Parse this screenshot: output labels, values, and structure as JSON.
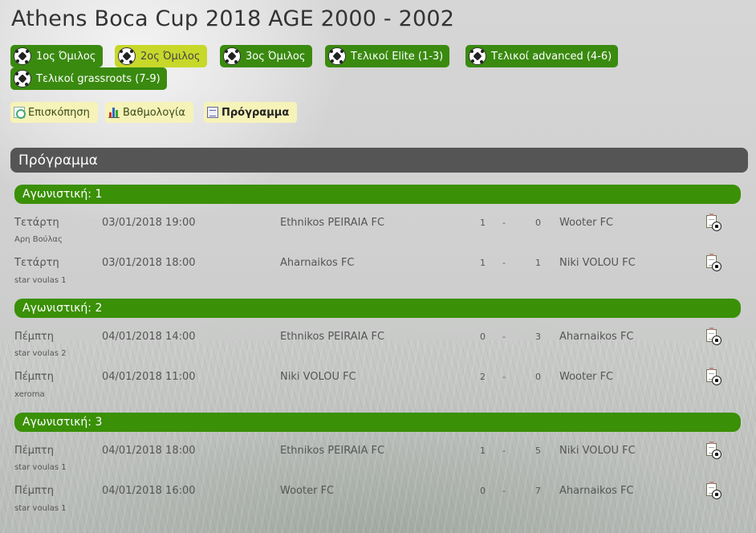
{
  "title": "Athens Boca Cup 2018 AGE 2000 - 2002",
  "groups": [
    {
      "label": "1ος Όμιλος"
    },
    {
      "label": "2ος Όμιλος"
    },
    {
      "label": "3ος Όμιλος"
    },
    {
      "label": "Τελικοί Elite (1-3)"
    },
    {
      "label": "Τελικοί advanced (4-6)"
    },
    {
      "label": "Τελικοί grassroots (7-9)"
    }
  ],
  "active_group": "2ος Όμιλος",
  "subtabs": [
    {
      "label": "Επισκόπηση",
      "icon": "overview-icon"
    },
    {
      "label": "Βαθμολογία",
      "icon": "standings-chart-icon"
    },
    {
      "label": "Πρόγραμμα",
      "icon": "schedule-icon"
    }
  ],
  "active_subtab": "Πρόγραμμα",
  "section_title": "Πρόγραμμα",
  "rounds": [
    {
      "label": "Αγωνιστική: 1",
      "matches": [
        {
          "day": "Τετάρτη",
          "venue": "Αρη Βούλας",
          "datetime": "03/01/2018 19:00",
          "home": "Ethnikos PEIRAIA FC",
          "home_score": "1",
          "sep": "-",
          "away_score": "0",
          "away": "Wooter FC"
        },
        {
          "day": "Τετάρτη",
          "venue": "star voulas 1",
          "datetime": "03/01/2018 18:00",
          "home": "Aharnaikos FC",
          "home_score": "1",
          "sep": "-",
          "away_score": "1",
          "away": "Niki VOLOU FC"
        }
      ]
    },
    {
      "label": "Αγωνιστική: 2",
      "matches": [
        {
          "day": "Πέμπτη",
          "venue": "star voulas 2",
          "datetime": "04/01/2018 14:00",
          "home": "Ethnikos PEIRAIA FC",
          "home_score": "0",
          "sep": "-",
          "away_score": "3",
          "away": "Aharnaikos FC"
        },
        {
          "day": "Πέμπτη",
          "venue": "xeroma",
          "datetime": "04/01/2018 11:00",
          "home": "Niki VOLOU FC",
          "home_score": "2",
          "sep": "-",
          "away_score": "0",
          "away": "Wooter FC"
        }
      ]
    },
    {
      "label": "Αγωνιστική: 3",
      "matches": [
        {
          "day": "Πέμπτη",
          "venue": "star voulas 1",
          "datetime": "04/01/2018 18:00",
          "home": "Ethnikos PEIRAIA FC",
          "home_score": "1",
          "sep": "-",
          "away_score": "5",
          "away": "Niki VOLOU FC"
        },
        {
          "day": "Πέμπτη",
          "venue": "star voulas 1",
          "datetime": "04/01/2018 16:00",
          "home": "Wooter FC",
          "home_score": "0",
          "sep": "-",
          "away_score": "7",
          "away": "Aharnaikos FC"
        }
      ]
    }
  ],
  "colors": {
    "tab_green": "#3a8a10",
    "tab_active": "#c7d82a",
    "round_green": "#3a9006",
    "section_gray": "#555555",
    "subtab_yellow": "#f6f3b8"
  }
}
